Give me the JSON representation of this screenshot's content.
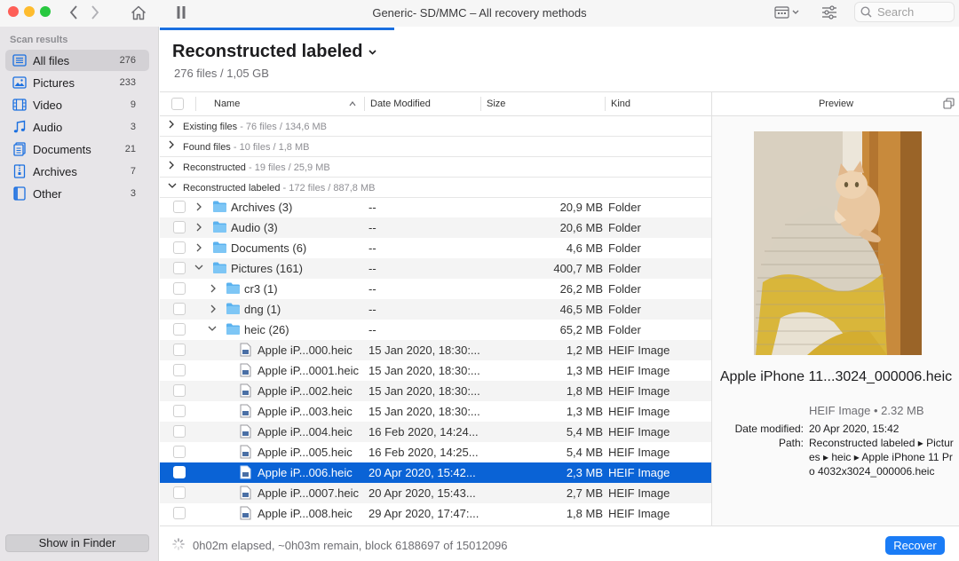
{
  "window": {
    "title": "Generic- SD/MMC – All recovery methods"
  },
  "toolbar": {
    "search_placeholder": "Search"
  },
  "sidebar": {
    "header": "Scan results",
    "items": [
      {
        "label": "All files",
        "count": "276",
        "icon": "all-files-icon"
      },
      {
        "label": "Pictures",
        "count": "233",
        "icon": "pictures-icon"
      },
      {
        "label": "Video",
        "count": "9",
        "icon": "video-icon"
      },
      {
        "label": "Audio",
        "count": "3",
        "icon": "audio-icon"
      },
      {
        "label": "Documents",
        "count": "21",
        "icon": "documents-icon"
      },
      {
        "label": "Archives",
        "count": "7",
        "icon": "archives-icon"
      },
      {
        "label": "Other",
        "count": "3",
        "icon": "other-icon"
      }
    ],
    "finder_button": "Show in Finder"
  },
  "main": {
    "title": "Reconstructed labeled",
    "subtitle": "276 files / 1,05 GB"
  },
  "table": {
    "columns": {
      "name": "Name",
      "date": "Date Modified",
      "size": "Size",
      "kind": "Kind"
    },
    "groups": [
      {
        "name": "Existing files",
        "meta": " - 76 files / 134,6 MB"
      },
      {
        "name": "Found files",
        "meta": " - 10 files / 1,8 MB"
      },
      {
        "name": "Reconstructed",
        "meta": " - 19 files / 25,9 MB"
      },
      {
        "name": "Reconstructed labeled",
        "meta": " - 172 files / 887,8 MB"
      }
    ],
    "rows": [
      {
        "name": "Archives (3)",
        "date": "--",
        "size": "20,9 MB",
        "kind": "Folder"
      },
      {
        "name": "Audio (3)",
        "date": "--",
        "size": "20,6 MB",
        "kind": "Folder"
      },
      {
        "name": "Documents (6)",
        "date": "--",
        "size": "4,6 MB",
        "kind": "Folder"
      },
      {
        "name": "Pictures (161)",
        "date": "--",
        "size": "400,7 MB",
        "kind": "Folder"
      },
      {
        "name": "cr3 (1)",
        "date": "--",
        "size": "26,2 MB",
        "kind": "Folder"
      },
      {
        "name": "dng (1)",
        "date": "--",
        "size": "46,5 MB",
        "kind": "Folder"
      },
      {
        "name": "heic (26)",
        "date": "--",
        "size": "65,2 MB",
        "kind": "Folder"
      },
      {
        "name": "Apple iP...000.heic",
        "date": "15 Jan 2020, 18:30:...",
        "size": "1,2 MB",
        "kind": "HEIF Image"
      },
      {
        "name": "Apple iP...0001.heic",
        "date": "15 Jan 2020, 18:30:...",
        "size": "1,3 MB",
        "kind": "HEIF Image"
      },
      {
        "name": "Apple iP...002.heic",
        "date": "15 Jan 2020, 18:30:...",
        "size": "1,8 MB",
        "kind": "HEIF Image"
      },
      {
        "name": "Apple iP...003.heic",
        "date": "15 Jan 2020, 18:30:...",
        "size": "1,3 MB",
        "kind": "HEIF Image"
      },
      {
        "name": "Apple iP...004.heic",
        "date": "16 Feb 2020, 14:24...",
        "size": "5,4 MB",
        "kind": "HEIF Image"
      },
      {
        "name": "Apple iP...005.heic",
        "date": "16 Feb 2020, 14:25...",
        "size": "5,4 MB",
        "kind": "HEIF Image"
      },
      {
        "name": "Apple iP...006.heic",
        "date": "20 Apr 2020, 15:42...",
        "size": "2,3 MB",
        "kind": "HEIF Image"
      },
      {
        "name": "Apple iP...0007.heic",
        "date": "20 Apr 2020, 15:43...",
        "size": "2,7 MB",
        "kind": "HEIF Image"
      },
      {
        "name": "Apple iP...008.heic",
        "date": "29 Apr 2020, 17:47:...",
        "size": "1,8 MB",
        "kind": "HEIF Image"
      }
    ]
  },
  "preview": {
    "header": "Preview",
    "filename": "Apple iPhone 11...3024_000006.heic",
    "kind_size": "HEIF Image • 2.32 MB",
    "date_label": "Date modified:",
    "date_value": "20 Apr 2020, 15:42",
    "path_label": "Path:",
    "path_value": "Reconstructed labeled ▸ Pictures ▸ heic ▸ Apple iPhone 11 Pro 4032x3024_000006.heic"
  },
  "status": {
    "text": "0h02m elapsed, ~0h03m remain, block 6188697 of 15012096",
    "recover_button": "Recover"
  },
  "colors": {
    "accent": "#0a63d6",
    "folder": "#5ab2ef",
    "sidebar_bg": "#e7e5e8"
  }
}
